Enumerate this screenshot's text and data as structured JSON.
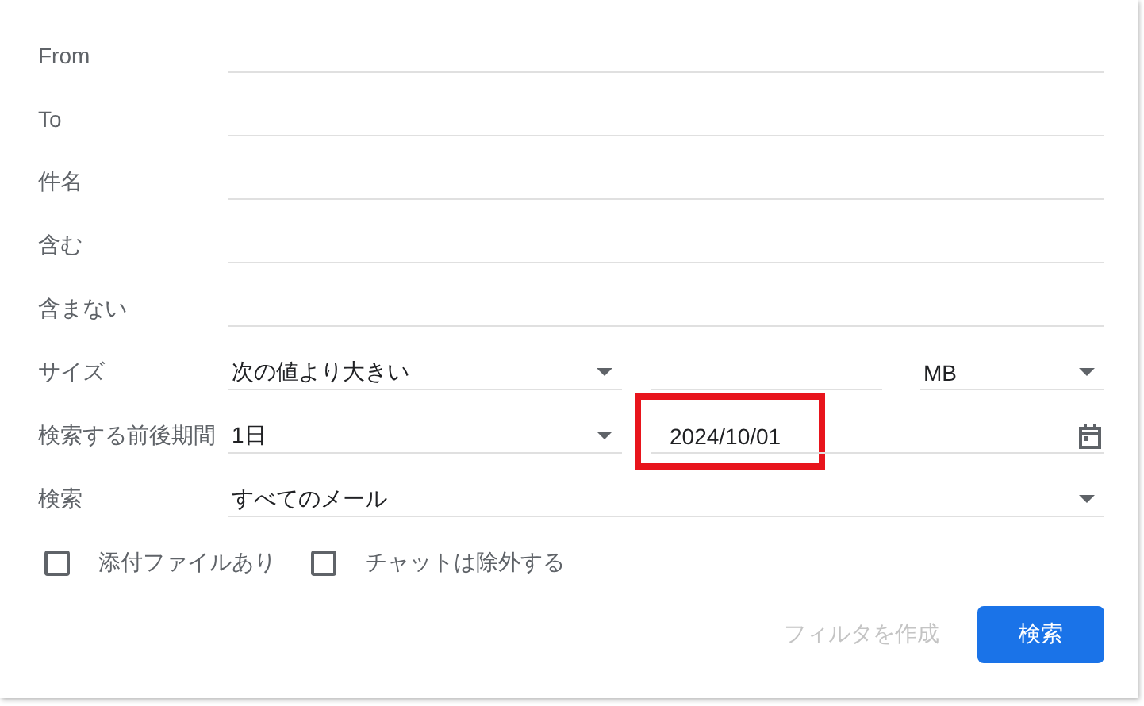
{
  "fields": [
    {
      "label": "From",
      "kind": "text"
    },
    {
      "label": "To",
      "kind": "text"
    },
    {
      "label": "件名",
      "kind": "text"
    },
    {
      "label": "含む",
      "kind": "text"
    },
    {
      "label": "含まない",
      "kind": "text"
    },
    {
      "label": "サイズ",
      "kind": "size",
      "comparison": "次の値より大きい",
      "unit": "MB"
    },
    {
      "label": "検索する前後期間",
      "kind": "period",
      "range": "1日",
      "date": "2024/10/01",
      "highlighted": true
    },
    {
      "label": "検索",
      "kind": "select",
      "value": "すべてのメール"
    }
  ],
  "checkboxes": [
    {
      "label": "添付ファイルあり",
      "checked": false
    },
    {
      "label": "チャットは除外する",
      "checked": false
    }
  ],
  "buttons": [
    {
      "label": "フィルタを作成",
      "disabled": true
    },
    {
      "label": "検索",
      "disabled": false
    }
  ]
}
